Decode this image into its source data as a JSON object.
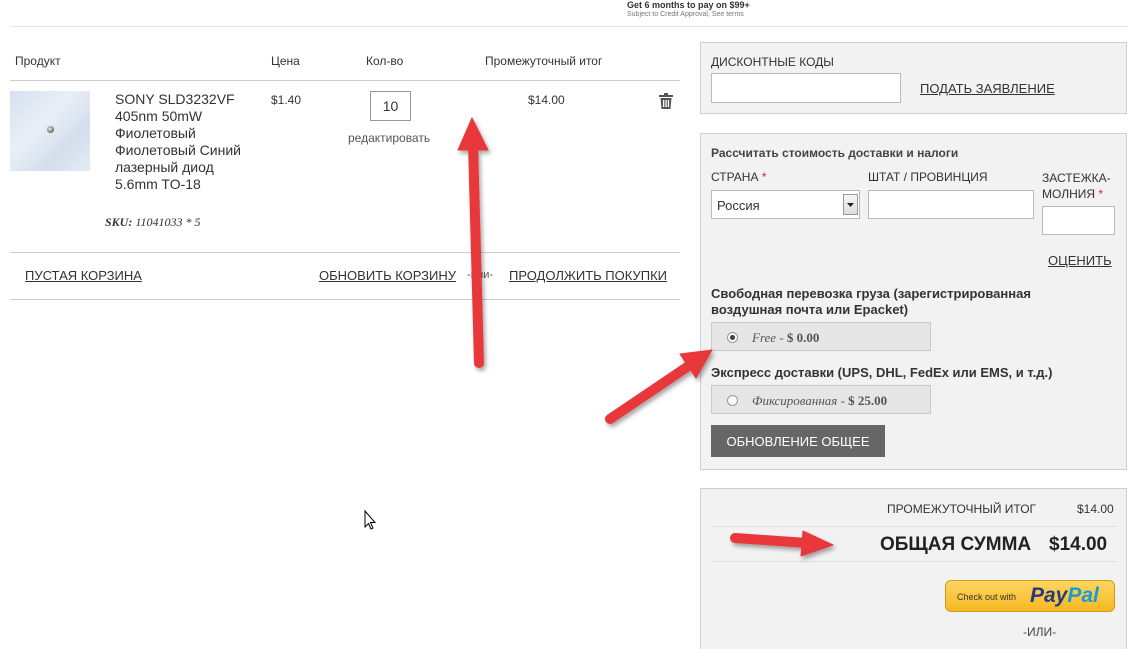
{
  "promo": {
    "line1": "Get 6 months to pay on $99+",
    "line2": "Subject to Credit Approval, See terms"
  },
  "cart": {
    "headers": {
      "product": "Продукт",
      "price": "Цена",
      "qty": "Кол-во",
      "subtotal": "Промежуточный итог"
    },
    "item": {
      "name": "SONY SLD3232VF 405nm 50mW Фиолетовый Фиолетовый Синий лазерный диод 5.6mm TO-18",
      "sku_label": "SKU:",
      "sku_value": "11041033 * 5",
      "price": "$1.40",
      "qty": "10",
      "edit": "редактировать",
      "subtotal": "$14.00",
      "delete_icon": "trash-icon"
    },
    "actions": {
      "empty": "ПУСТАЯ КОРЗИНА",
      "update": "ОБНОВИТЬ КОРЗИНУ",
      "or": "-или-",
      "continue": "ПРОДОЛЖИТЬ ПОКУПКИ"
    }
  },
  "discount": {
    "label": "ДИСКОНТНЫЕ КОДЫ",
    "input_value": "",
    "apply": "ПОДАТЬ ЗАЯВЛЕНИЕ"
  },
  "shipping": {
    "title": "Рассчитать стоимость доставки и налоги",
    "country_label": "СТРАНА",
    "state_label": "ШТАТ / ПРОВИНЦИЯ",
    "zip_label_1": "ЗАСТЕЖКА-",
    "zip_label_2": "МОЛНИЯ",
    "required_mark": "*",
    "country_value": "Россия",
    "state_value": "",
    "zip_value": "",
    "estimate": "ОЦЕНИТЬ",
    "free_title": "Свободная перевозка груза (зарегистрированная воздушная почта или Epacket)",
    "free_option_name": "Free",
    "free_option_price": "$ 0.00",
    "express_title": "Экспресс доставки (UPS, DHL, FedEx или EMS, и т.д.)",
    "express_option_name": "Фиксированная",
    "express_option_price": "$ 25.00",
    "update_total": "ОБНОВЛЕНИЕ ОБЩЕЕ"
  },
  "totals": {
    "subtotal_label": "ПРОМЕЖУТОЧНЫЙ ИТОГ",
    "subtotal_value": "$14.00",
    "grand_label": "ОБЩАЯ СУММА",
    "grand_value": "$14.00",
    "paypal_prefix": "Check out with",
    "paypal_brand_1": "Pay",
    "paypal_brand_2": "Pal",
    "or": "-ИЛИ-"
  },
  "colors": {
    "annotation_arrow": "#e8393a",
    "panel_bg": "#f2f2f2",
    "button_dark": "#666666"
  }
}
